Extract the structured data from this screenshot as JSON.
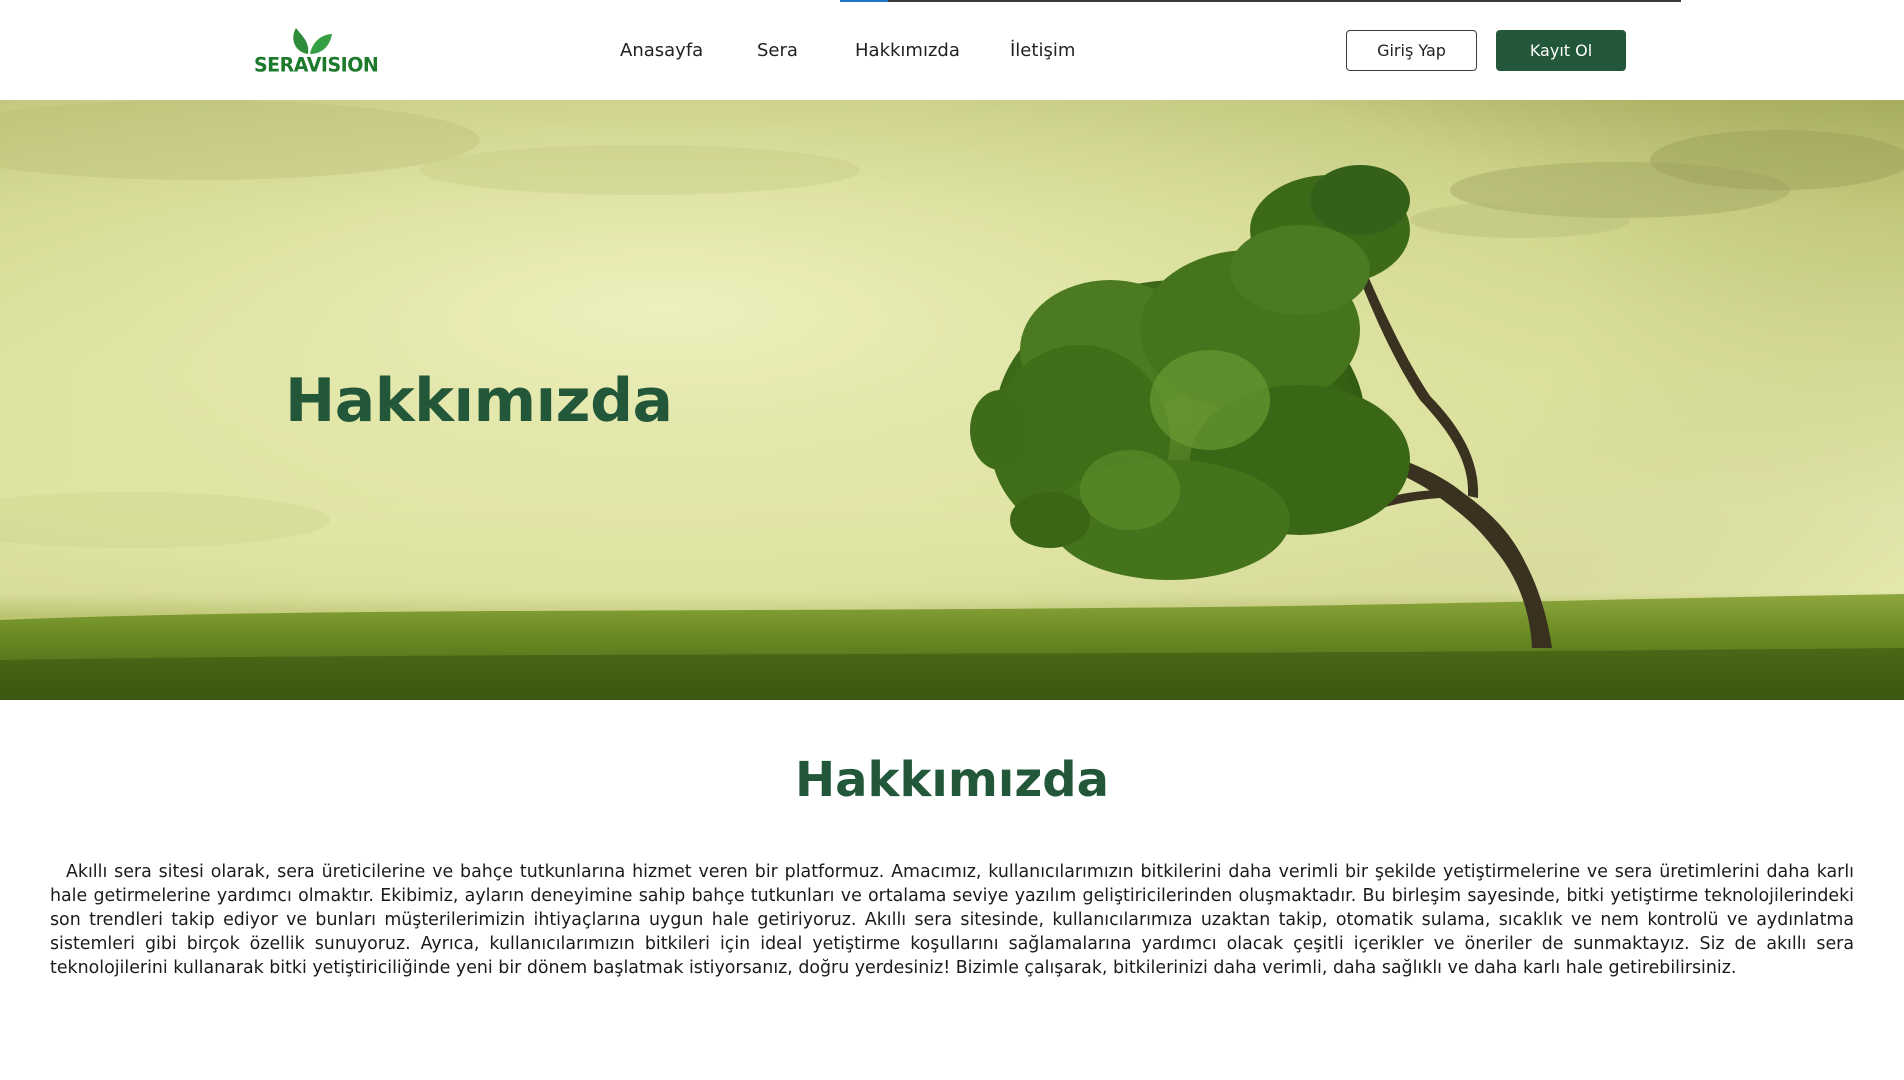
{
  "header": {
    "logo_text": "SERAVISION",
    "nav": [
      {
        "label": "Anasayfa"
      },
      {
        "label": "Sera"
      },
      {
        "label": "Hakkımızda"
      },
      {
        "label": "İletişim"
      }
    ],
    "login_label": "Giriş Yap",
    "register_label": "Kayıt Ol"
  },
  "hero": {
    "title": "Hakkımızda"
  },
  "about": {
    "title": "Hakkımızda",
    "text": "Akıllı sera sitesi olarak, sera üreticilerine ve bahçe tutkunlarına hizmet veren bir platformuz. Amacımız, kullanıcılarımızın bitkilerini daha verimli bir şekilde yetiştirmelerine ve sera üretimlerini daha karlı hale getirmelerine yardımcı olmaktır. Ekibimiz, ayların deneyimine sahip bahçe tutkunları ve ortalama seviye yazılım geliştiricilerinden oluşmaktadır. Bu birleşim sayesinde, bitki yetiştirme teknolojilerindeki son trendleri takip ediyor ve bunları müşterilerimizin ihtiyaçlarına uygun hale getiriyoruz. Akıllı sera sitesinde, kullanıcılarımıza uzaktan takip, otomatik sulama, sıcaklık ve nem kontrolü ve aydınlatma sistemleri gibi birçok özellik sunuyoruz. Ayrıca, kullanıcılarımızın bitkileri için ideal yetiştirme koşullarını sağlamalarına yardımcı olacak çeşitli içerikler ve öneriler de sunmaktayız. Siz de akıllı sera teknolojilerini kullanarak bitki yetiştiriciliğinde yeni bir dönem başlatmak istiyorsanız, doğru yerdesiniz! Bizimle çalışarak, bitkilerinizi daha verimli, daha sağlıklı ve daha karlı hale getirebilirsiniz."
  },
  "colors": {
    "brand_green": "#22573a",
    "logo_green": "#1d7a2c",
    "nav_active_accent": "#1e74c8"
  }
}
